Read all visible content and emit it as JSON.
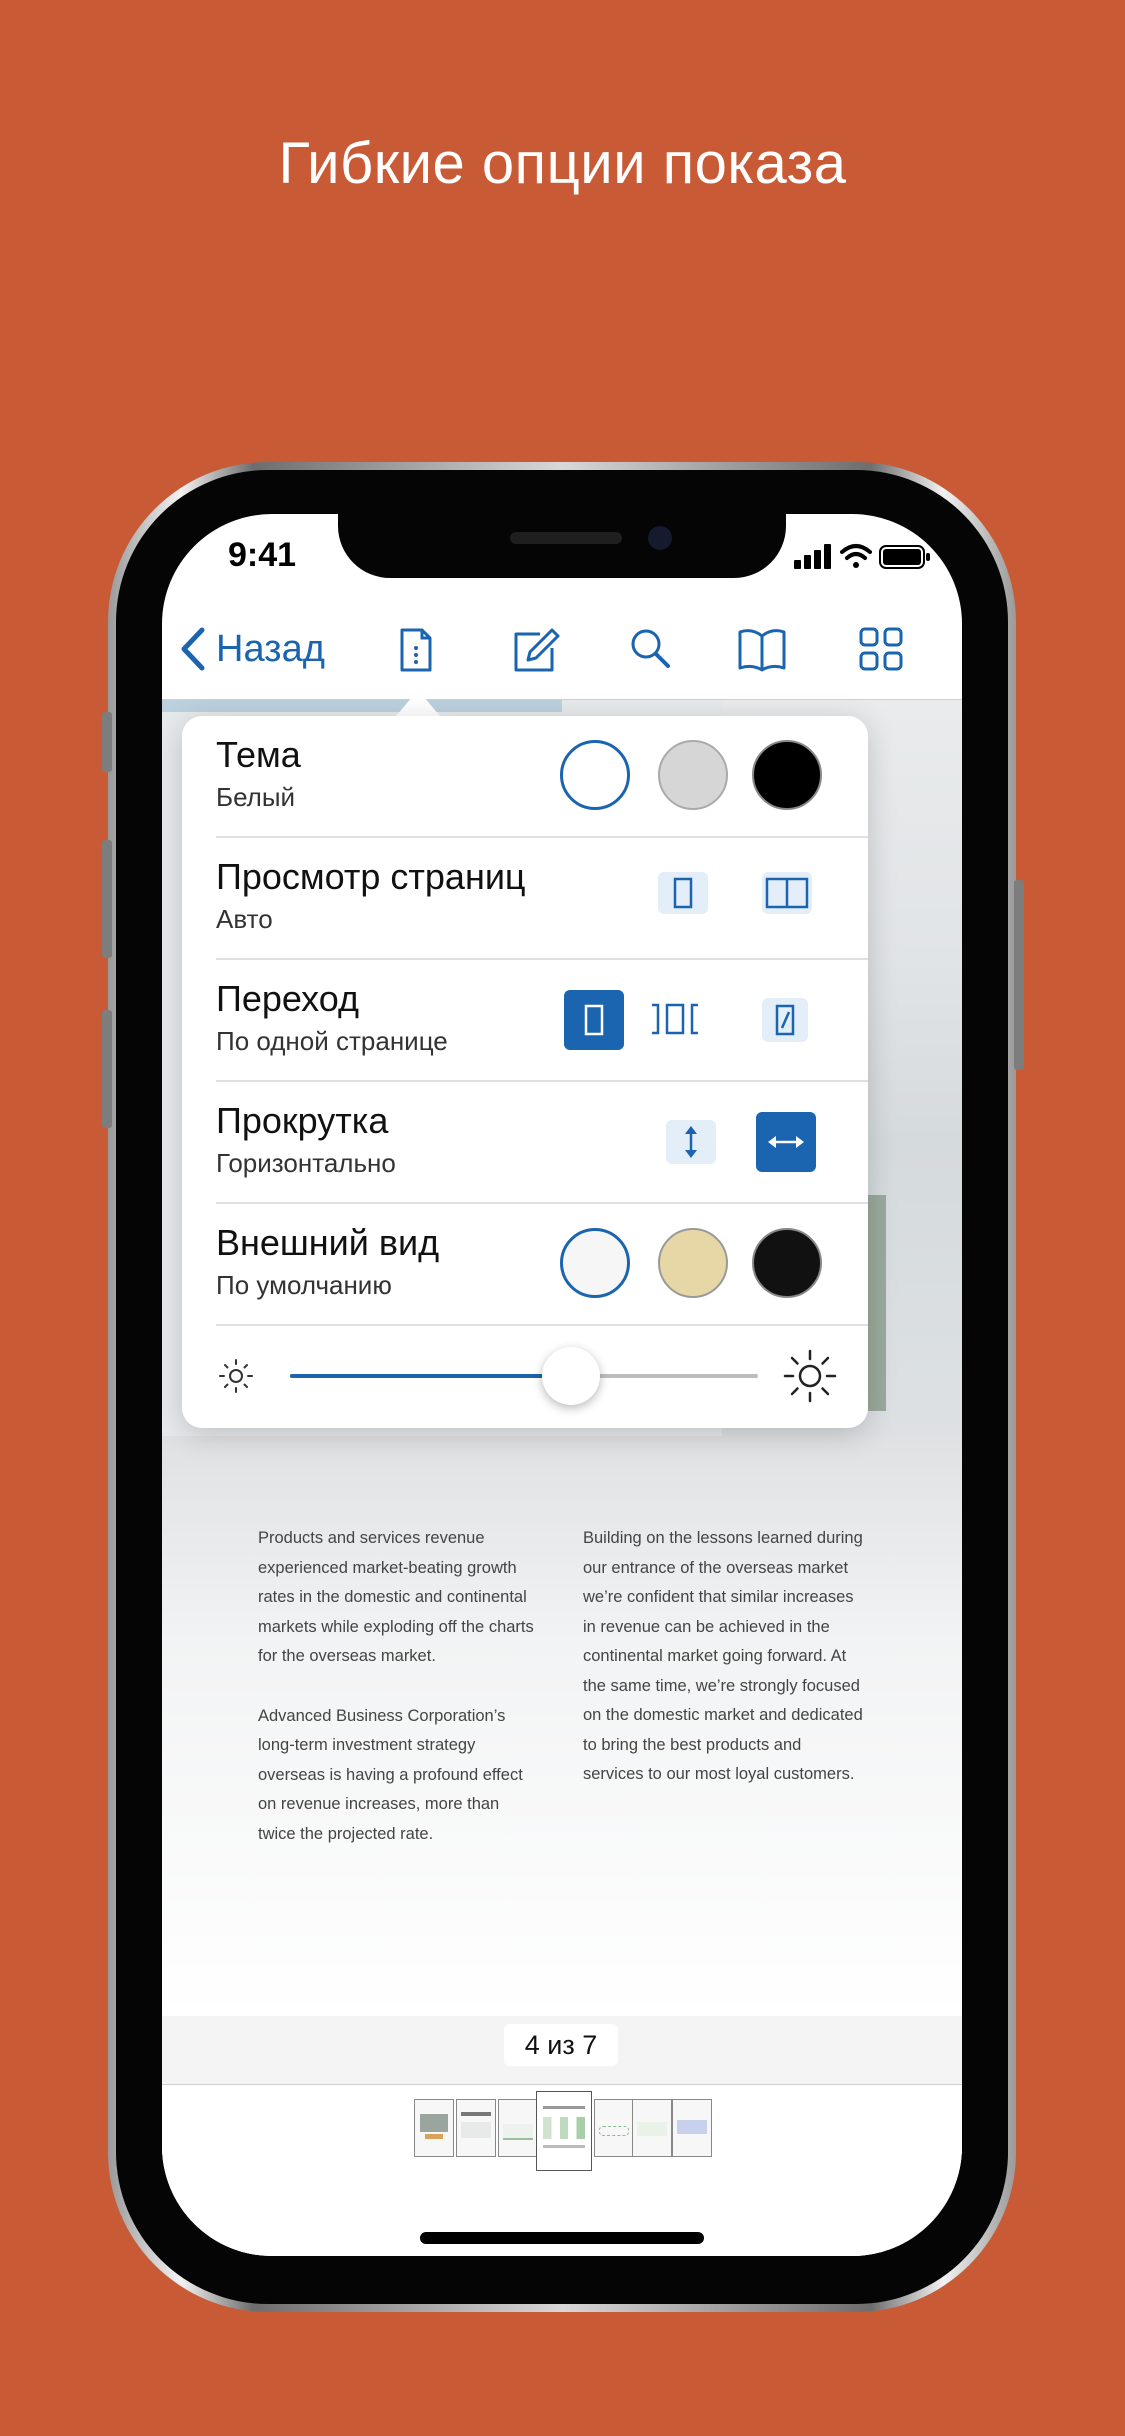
{
  "headline": "Гибкие опции показа",
  "status": {
    "time": "9:41"
  },
  "nav": {
    "back_label": "Назад",
    "icons": [
      "document-icon",
      "edit-icon",
      "search-icon",
      "book-icon",
      "grid-icon"
    ],
    "accent": "#1A64B0"
  },
  "settings": {
    "theme": {
      "title": "Тема",
      "value": "Белый",
      "options": [
        "white",
        "gray",
        "black"
      ],
      "selected": "white"
    },
    "page_view": {
      "title": "Просмотр страниц",
      "value": "Авто",
      "options": [
        "single-page",
        "two-page"
      ]
    },
    "transition": {
      "title": "Переход",
      "value": "По одной странице",
      "options": [
        "single-page",
        "scroll-pages",
        "page-curl"
      ],
      "selected": "single-page"
    },
    "scroll": {
      "title": "Прокрутка",
      "value": "Горизонтально",
      "options": [
        "vertical",
        "horizontal"
      ],
      "selected": "horizontal"
    },
    "appearance": {
      "title": "Внешний вид",
      "value": "По умолчанию",
      "options": [
        "default-white",
        "sepia",
        "black"
      ],
      "selected": "default-white"
    },
    "brightness": {
      "level": 0.6
    }
  },
  "document": {
    "col1_p1": "Products and services revenue experi­enced market-beating growth rates in the domestic and continental markets while exploding off the charts for the overseas market.",
    "col1_p2": "Advanced Business Corporation’s long-term investment strategy overseas is having a profound effect on revenue in­creases, more than twice the projected rate.",
    "col2_p1": "Building on the lessons learned during our entrance of the overseas market we’re confident that similar increases in revenue can be achieved in the con­tinental market going forward. At the same time, we’re strongly focused on the domestic market and dedicated to bring the best products and services to our most loyal customers."
  },
  "pager": {
    "label": "4 из 7",
    "current": 4,
    "total": 7
  }
}
